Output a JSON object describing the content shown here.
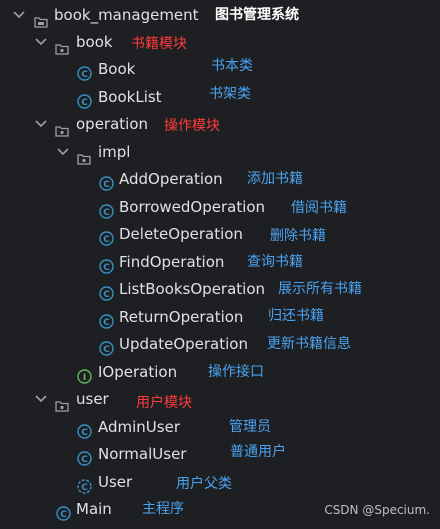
{
  "tree": {
    "root": {
      "label": "book_management",
      "note": "图书管理系统"
    },
    "book": {
      "label": "book",
      "note": "书籍模块"
    },
    "book_cls": {
      "label": "Book",
      "note": "书本类"
    },
    "booklist_cls": {
      "label": "BookList",
      "note": "书架类"
    },
    "operation": {
      "label": "operation",
      "note": "操作模块"
    },
    "impl": {
      "label": "impl"
    },
    "add": {
      "label": "AddOperation",
      "note": "添加书籍"
    },
    "borrowed": {
      "label": "BorrowedOperation",
      "note": "借阅书籍"
    },
    "delete": {
      "label": "DeleteOperation",
      "note": "删除书籍"
    },
    "find": {
      "label": "FindOperation",
      "note": "查询书籍"
    },
    "listbooks": {
      "label": "ListBooksOperation",
      "note": "展示所有书籍"
    },
    "return": {
      "label": "ReturnOperation",
      "note": "归还书籍"
    },
    "update": {
      "label": "UpdateOperation",
      "note": "更新书籍信息"
    },
    "ioperation": {
      "label": "IOperation",
      "note": "操作接口"
    },
    "user": {
      "label": "user",
      "note": "用户模块"
    },
    "admin": {
      "label": "AdminUser",
      "note": "管理员"
    },
    "normal": {
      "label": "NormalUser",
      "note": "普通用户"
    },
    "user_cls": {
      "label": "User",
      "note": "用户父类"
    },
    "main": {
      "label": "Main",
      "note": "主程序"
    }
  },
  "watermark": "CSDN @Specium.",
  "colors": {
    "background": "#1e1f22",
    "class_icon": "#3592c4",
    "interface_icon": "#5fb760",
    "note_blue": "#4aa3f0",
    "note_red": "#ff3b3b"
  }
}
